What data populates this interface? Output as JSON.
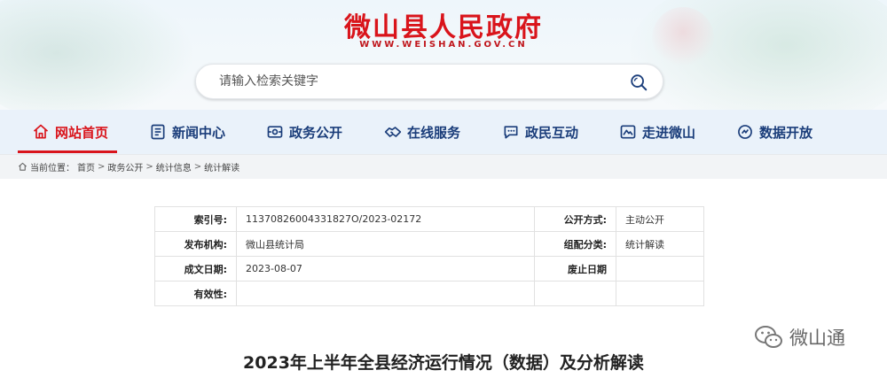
{
  "header": {
    "site_title": "微山县人民政府",
    "site_domain": "WWW.WEISHAN.GOV.CN",
    "search_placeholder": "请输入检索关键字"
  },
  "nav": {
    "items": [
      {
        "label": "网站首页",
        "icon": "home-icon",
        "active": true
      },
      {
        "label": "新闻中心",
        "icon": "news-icon",
        "active": false
      },
      {
        "label": "政务公开",
        "icon": "government-icon",
        "active": false
      },
      {
        "label": "在线服务",
        "icon": "handshake-icon",
        "active": false
      },
      {
        "label": "政民互动",
        "icon": "chat-icon",
        "active": false
      },
      {
        "label": "走进微山",
        "icon": "map-icon",
        "active": false
      },
      {
        "label": "数据开放",
        "icon": "data-globe-icon",
        "active": false
      }
    ]
  },
  "breadcrumb": {
    "prefix": "当前位置：",
    "items": [
      "首页",
      "政务公开",
      "统计信息",
      "统计解读"
    ],
    "separator": ">"
  },
  "info_table": {
    "rows": [
      {
        "k1": "索引号:",
        "v1": "11370826004331827O/2023-02172",
        "k2": "公开方式:",
        "v2": "主动公开"
      },
      {
        "k1": "发布机构:",
        "v1": "微山县统计局",
        "k2": "组配分类:",
        "v2": "统计解读"
      },
      {
        "k1": "成文日期:",
        "v1": "2023-08-07",
        "k2": "废止日期",
        "v2": ""
      },
      {
        "k1": "有效性:",
        "v1": "",
        "k2": "",
        "v2": ""
      }
    ]
  },
  "article": {
    "title": "2023年上半年全县经济运行情况（数据）及分析解读"
  },
  "watermark": {
    "label": "微山通",
    "icon": "wechat-icon"
  },
  "colors": {
    "brand_red": "#d9141b",
    "nav_text": "#1a3d7a",
    "nav_bg": "#eaf2fa"
  }
}
